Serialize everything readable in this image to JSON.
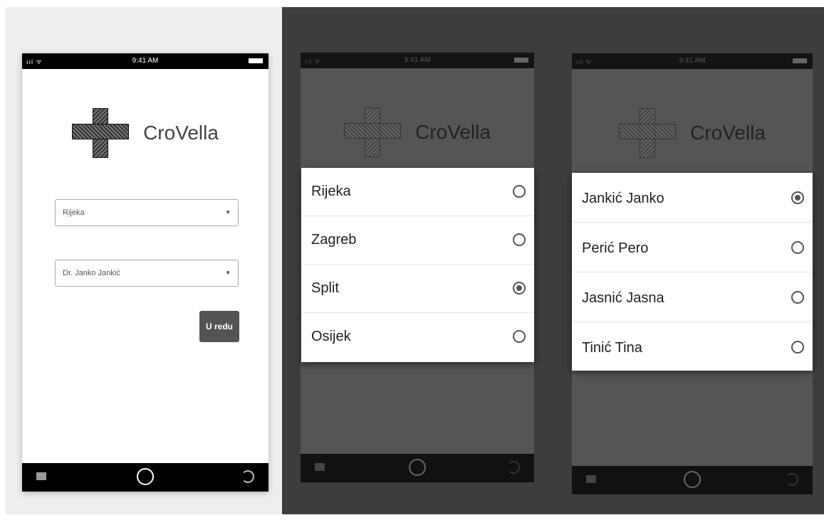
{
  "status_bar": {
    "time": "9:41 AM",
    "signal": "ııl ᯤ"
  },
  "app": {
    "name": "CroVella"
  },
  "form": {
    "city_value": "Rijeka",
    "doctor_value": "Dr. Janko Jankić",
    "ok_label": "U redu"
  },
  "city_dialog": {
    "options": [
      {
        "label": "Rijeka",
        "selected": false
      },
      {
        "label": "Zagreb",
        "selected": false
      },
      {
        "label": "Split",
        "selected": true
      },
      {
        "label": "Osijek",
        "selected": false
      }
    ]
  },
  "doctor_dialog": {
    "options": [
      {
        "label": "Jankić Janko",
        "selected": true
      },
      {
        "label": "Perić Pero",
        "selected": false
      },
      {
        "label": "Jasnić Jasna",
        "selected": false
      },
      {
        "label": "Tinić Tina",
        "selected": false
      }
    ]
  },
  "icons": {
    "nav_menu": "menu-icon",
    "nav_home": "home-icon",
    "nav_back": "back-icon",
    "dropdown": "chevron-down-icon",
    "logo": "medical-cross-logo"
  },
  "colors": {
    "dark_bg": "#3d3d3d",
    "button": "#545454",
    "overlay": "#555555"
  }
}
